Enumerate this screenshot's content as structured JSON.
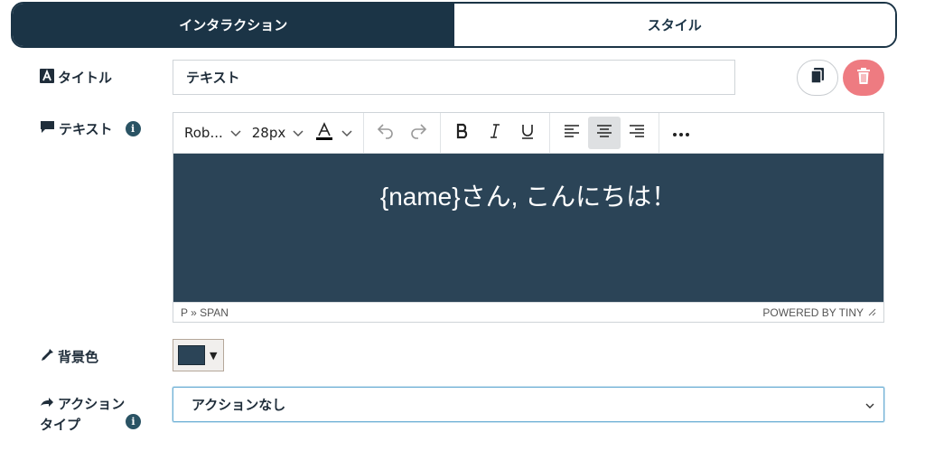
{
  "tabs": {
    "interaction": "インタラクション",
    "style": "スタイル"
  },
  "title_row": {
    "label": "タイトル",
    "value": "テキスト"
  },
  "text_row": {
    "label": "テキスト"
  },
  "editor": {
    "font_family": "Rob...",
    "font_size": "28px",
    "content": "{name}さん, こんにちは！",
    "status_path": "P » SPAN",
    "powered_by": "POWERED BY TINY",
    "content_bg": "#2b4457"
  },
  "background_row": {
    "label": "背景色",
    "color": "#2b4457"
  },
  "action_row": {
    "label_line1": "アクション",
    "label_line2": "タイプ",
    "selected": "アクションなし"
  },
  "colors": {
    "primary": "#1b3446",
    "danger": "#ee7b81"
  }
}
